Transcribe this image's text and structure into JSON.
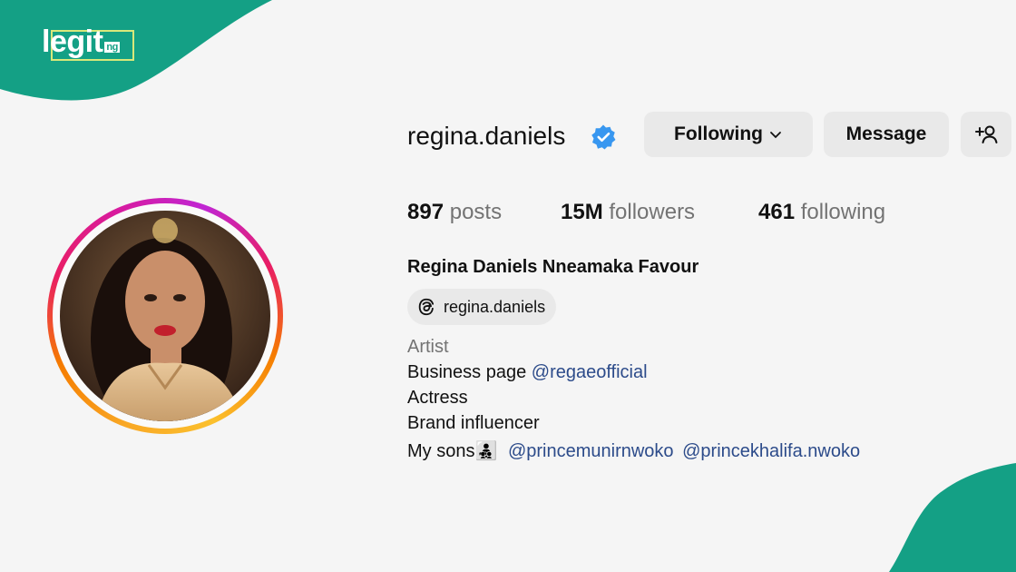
{
  "brand": {
    "logo_text": "legit",
    "logo_sub": "ng",
    "accent_color": "#14a085"
  },
  "profile": {
    "username": "regina.daniels",
    "verified": true,
    "buttons": {
      "following": "Following",
      "message": "Message",
      "add_user_icon": "person-plus-icon"
    },
    "stats": {
      "posts_count": "897",
      "posts_label": "posts",
      "followers_count": "15M",
      "followers_label": "followers",
      "following_count": "461",
      "following_label": "following"
    },
    "full_name": "Regina Daniels Nneamaka Favour",
    "threads_handle": "regina.daniels",
    "bio": {
      "category": "Artist",
      "line1_text": "Business page ",
      "line1_mention": "@regaeofficial",
      "line2": "Actress",
      "line3": "Brand influencer",
      "line4_text": "My sons",
      "line4_emoji": "👨‍👧‍👦",
      "line4_mention1": "@princemunirnwoko",
      "line4_mention2": "@princekhalifa.nwoko"
    }
  }
}
